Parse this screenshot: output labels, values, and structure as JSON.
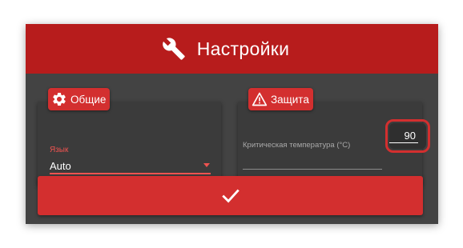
{
  "dialog": {
    "title": "Настройки",
    "title_icon": "wrench-icon"
  },
  "general": {
    "chip_label": "Общие",
    "chip_icon": "gear-icon",
    "language": {
      "label": "Язык",
      "value": "Auto"
    }
  },
  "security": {
    "chip_label": "Защита",
    "chip_icon": "warning-icon",
    "critical_temperature": {
      "label": "Критическая температура (°C)",
      "value": "90"
    }
  },
  "confirm_button": {
    "icon": "checkmark-icon"
  },
  "colors": {
    "header": "#b71c1c",
    "accent": "#d32f2f",
    "dialog_background": "#434343",
    "card_background": "#3b3b3b",
    "highlight": "#d32f2f"
  }
}
